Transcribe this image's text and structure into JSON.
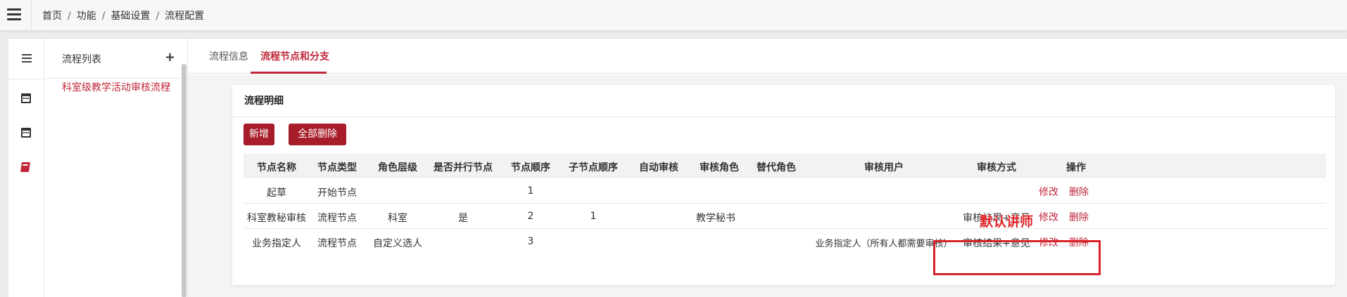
{
  "breadcrumb": [
    "首页",
    "功能",
    "基础设置",
    "流程配置"
  ],
  "sidebar": {
    "title": "流程列表",
    "items": [
      {
        "label": "科室级教学活动审核流程"
      }
    ]
  },
  "tabs": [
    {
      "label": "流程信息"
    },
    {
      "label": "流程节点和分支",
      "active": true
    }
  ],
  "card": {
    "title": "流程明细",
    "add_label": "新增",
    "delete_all_label": "全部删除"
  },
  "table": {
    "headers": [
      "节点名称",
      "节点类型",
      "角色层级",
      "是否并行节点",
      "节点顺序",
      "子节点顺序",
      "自动审核",
      "审核角色",
      "替代角色",
      "审核用户",
      "审核方式",
      "操作"
    ],
    "rows": [
      {
        "name": "起草",
        "type": "开始节点",
        "level": "",
        "parallel": "",
        "order": "1",
        "sub_order": "",
        "auto": "",
        "role": "",
        "alt_role": "",
        "user": "",
        "method": ""
      },
      {
        "name": "科室教秘审核",
        "type": "流程节点",
        "level": "科室",
        "parallel": "是",
        "order": "2",
        "sub_order": "1",
        "auto": "",
        "role": "教学秘书",
        "alt_role": "",
        "user": "",
        "method": "审核结果+意见"
      },
      {
        "name": "业务指定人",
        "type": "流程节点",
        "level": "自定义选人",
        "parallel": "",
        "order": "3",
        "sub_order": "",
        "auto": "",
        "role": "",
        "alt_role": "",
        "user": "业务指定人（所有人都需要审核）",
        "method": "审核结果+意见"
      }
    ],
    "op_edit": "修改",
    "op_delete": "删除"
  },
  "annotation": {
    "text": "默认讲师"
  },
  "colors": {
    "accent": "#c0283a",
    "button": "#a71d2a",
    "annotation": "#d8232a"
  }
}
